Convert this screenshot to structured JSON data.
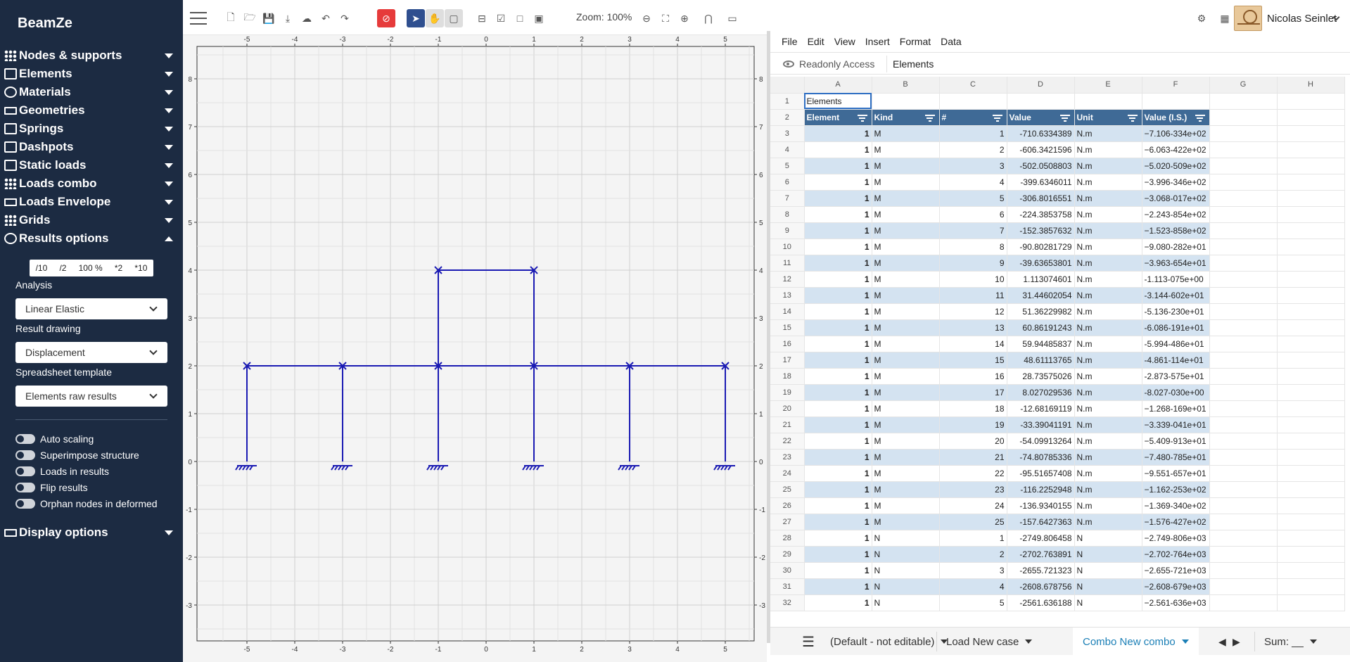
{
  "app": {
    "title": "BeamZe"
  },
  "sidebar": {
    "menu": [
      {
        "label": "Nodes & supports",
        "icon": "nodes-icon"
      },
      {
        "label": "Elements",
        "icon": "elements-icon"
      },
      {
        "label": "Materials",
        "icon": "materials-icon"
      },
      {
        "label": "Geometries",
        "icon": "geometries-icon"
      },
      {
        "label": "Springs",
        "icon": "springs-icon"
      },
      {
        "label": "Dashpots",
        "icon": "dashpots-icon"
      },
      {
        "label": "Static loads",
        "icon": "static-loads-icon"
      },
      {
        "label": "Loads combo",
        "icon": "loads-combo-icon"
      },
      {
        "label": "Loads Envelope",
        "icon": "loads-envelope-icon"
      },
      {
        "label": "Grids",
        "icon": "grids-icon"
      },
      {
        "label": "Results options",
        "icon": "results-options-icon"
      }
    ],
    "scale_buttons": [
      "/10",
      "/2",
      "100 %",
      "*2",
      "*10"
    ],
    "analysis_label": "Analysis",
    "analysis_value": "Linear Elastic",
    "result_drawing_label": "Result drawing",
    "result_drawing_value": "Displacement",
    "template_label": "Spreadsheet template",
    "template_value": "Elements raw results",
    "toggles": [
      "Auto scaling",
      "Superimpose structure",
      "Loads in results",
      "Flip results",
      "Orphan nodes in deformed"
    ],
    "display_options": "Display options"
  },
  "toolbar": {
    "zoom": "Zoom: 100%",
    "user": "Nicolas Seinlet"
  },
  "canvas": {
    "x_ticks": [
      "-5",
      "-4",
      "-3",
      "-2",
      "-1",
      "0",
      "1",
      "2",
      "3",
      "4",
      "5"
    ],
    "y_ticks": [
      "8",
      "7",
      "6",
      "5",
      "4",
      "3",
      "2",
      "1",
      "0",
      "-1",
      "-2",
      "-3"
    ],
    "structure_color": "#1a1ab3"
  },
  "sheet": {
    "menus": [
      "File",
      "Edit",
      "View",
      "Insert",
      "Format",
      "Data"
    ],
    "readonly": "Readonly Access",
    "cell_content": "Elements",
    "columns": [
      "A",
      "B",
      "C",
      "D",
      "E",
      "F",
      "G",
      "H"
    ],
    "title_cell": "Elements",
    "headers": [
      "Element",
      "Kind",
      "#",
      "Value",
      "Unit",
      "Value (I.S.)"
    ],
    "rows": [
      [
        "1",
        "M",
        "1",
        "-710.6334389",
        "N.m",
        "−7.106‑334e+02"
      ],
      [
        "1",
        "M",
        "2",
        "-606.3421596",
        "N.m",
        "−6.063‑422e+02"
      ],
      [
        "1",
        "M",
        "3",
        "-502.0508803",
        "N.m",
        "−5.020‑509e+02"
      ],
      [
        "1",
        "M",
        "4",
        "-399.6346011",
        "N.m",
        "−3.996‑346e+02"
      ],
      [
        "1",
        "M",
        "5",
        "-306.8016551",
        "N.m",
        "−3.068‑017e+02"
      ],
      [
        "1",
        "M",
        "6",
        "-224.3853758",
        "N.m",
        "−2.243‑854e+02"
      ],
      [
        "1",
        "M",
        "7",
        "-152.3857632",
        "N.m",
        "−1.523‑858e+02"
      ],
      [
        "1",
        "M",
        "8",
        "-90.80281729",
        "N.m",
        "−9.080‑282e+01"
      ],
      [
        "1",
        "M",
        "9",
        "-39.63653801",
        "N.m",
        "−3.963‑654e+01"
      ],
      [
        "1",
        "M",
        "10",
        "1.113074601",
        "N.m",
        "-1.113‑075e+00"
      ],
      [
        "1",
        "M",
        "11",
        "31.44602054",
        "N.m",
        "-3.144‑602e+01"
      ],
      [
        "1",
        "M",
        "12",
        "51.36229982",
        "N.m",
        "-5.136‑230e+01"
      ],
      [
        "1",
        "M",
        "13",
        "60.86191243",
        "N.m",
        "-6.086‑191e+01"
      ],
      [
        "1",
        "M",
        "14",
        "59.94485837",
        "N.m",
        "-5.994‑486e+01"
      ],
      [
        "1",
        "M",
        "15",
        "48.61113765",
        "N.m",
        "-4.861‑114e+01"
      ],
      [
        "1",
        "M",
        "16",
        "28.73575026",
        "N.m",
        "-2.873‑575e+01"
      ],
      [
        "1",
        "M",
        "17",
        "8.027029536",
        "N.m",
        "-8.027‑030e+00"
      ],
      [
        "1",
        "M",
        "18",
        "-12.68169119",
        "N.m",
        "−1.268‑169e+01"
      ],
      [
        "1",
        "M",
        "19",
        "-33.39041191",
        "N.m",
        "−3.339‑041e+01"
      ],
      [
        "1",
        "M",
        "20",
        "-54.09913264",
        "N.m",
        "−5.409‑913e+01"
      ],
      [
        "1",
        "M",
        "21",
        "-74.80785336",
        "N.m",
        "−7.480‑785e+01"
      ],
      [
        "1",
        "M",
        "22",
        "-95.51657408",
        "N.m",
        "−9.551‑657e+01"
      ],
      [
        "1",
        "M",
        "23",
        "-116.2252948",
        "N.m",
        "−1.162‑253e+02"
      ],
      [
        "1",
        "M",
        "24",
        "-136.9340155",
        "N.m",
        "−1.369‑340e+02"
      ],
      [
        "1",
        "M",
        "25",
        "-157.6427363",
        "N.m",
        "−1.576‑427e+02"
      ],
      [
        "1",
        "N",
        "1",
        "-2749.806458",
        "N",
        "−2.749‑806e+03"
      ],
      [
        "1",
        "N",
        "2",
        "-2702.763891",
        "N",
        "−2.702‑764e+03"
      ],
      [
        "1",
        "N",
        "3",
        "-2655.721323",
        "N",
        "−2.655‑721e+03"
      ],
      [
        "1",
        "N",
        "4",
        "-2608.678756",
        "N",
        "−2.608‑679e+03"
      ],
      [
        "1",
        "N",
        "5",
        "-2561.636188",
        "N",
        "−2.561‑636e+03"
      ]
    ],
    "bottom": {
      "template": "(Default - not editable)",
      "load_case": "Load New case",
      "combo": "Combo New combo",
      "sum": "Sum: __"
    }
  }
}
